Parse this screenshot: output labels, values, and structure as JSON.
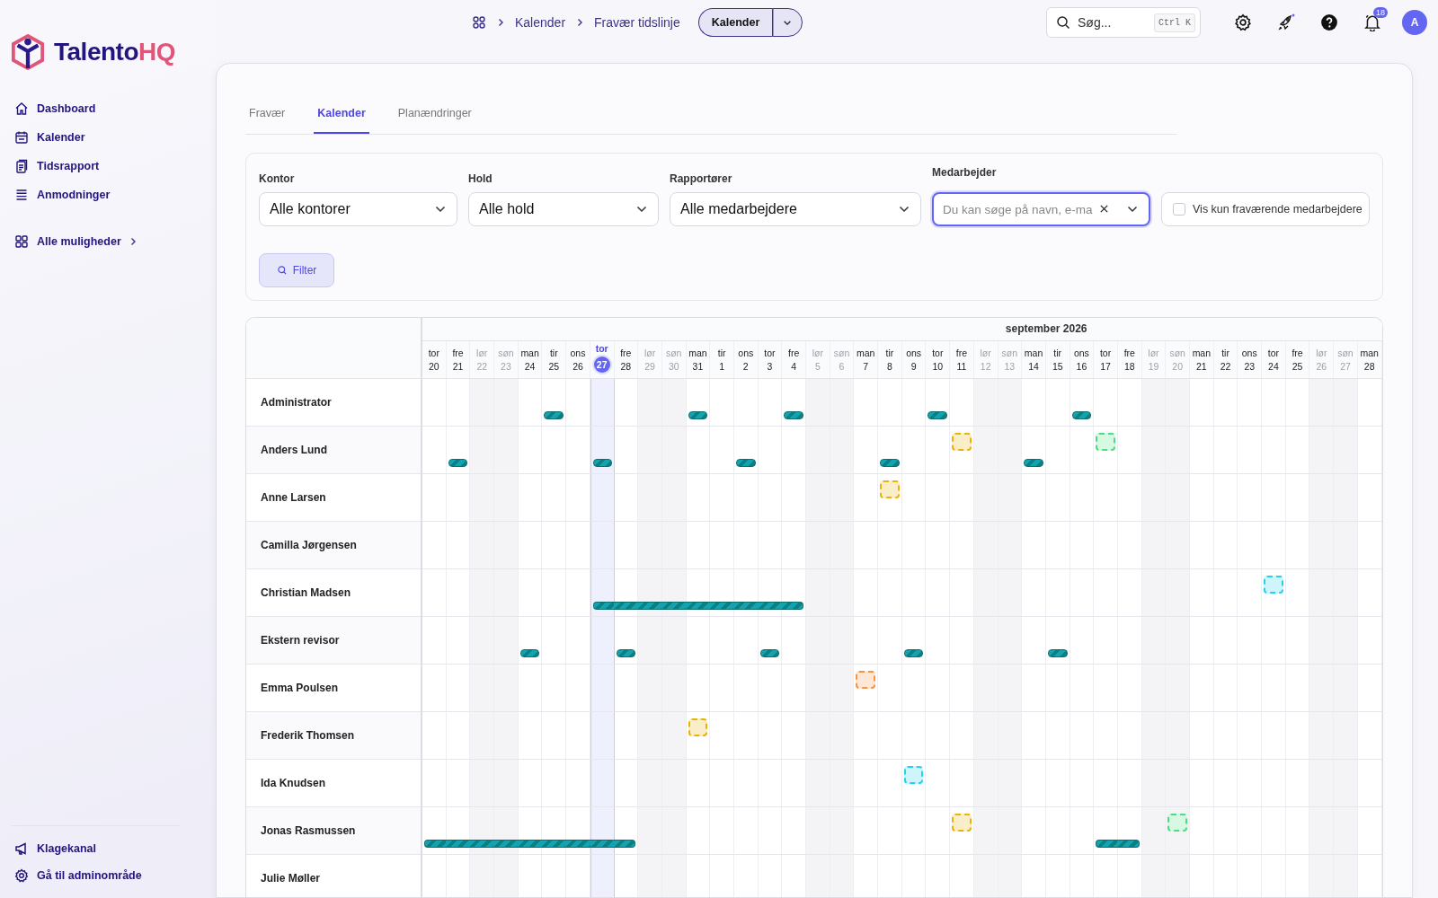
{
  "brand": {
    "name_part1": "Talento",
    "name_part2": "HQ"
  },
  "sidebar": {
    "items": [
      {
        "label": "Dashboard"
      },
      {
        "label": "Kalender"
      },
      {
        "label": "Tidsrapport"
      },
      {
        "label": "Anmodninger"
      }
    ],
    "more": {
      "label": "Alle muligheder"
    },
    "footer": [
      {
        "label": "Klagekanal"
      },
      {
        "label": "Gå til adminområde"
      }
    ]
  },
  "breadcrumbs": [
    "Kalender",
    "Fravær tidslinje"
  ],
  "view_switch": {
    "label": "Kalender"
  },
  "search": {
    "placeholder": "Søg...",
    "shortcut": "Ctrl K"
  },
  "notifications": {
    "count": "18"
  },
  "avatar": {
    "initial": "A"
  },
  "tabs": [
    {
      "label": "Fravær",
      "selected": false
    },
    {
      "label": "Kalender",
      "selected": true
    },
    {
      "label": "Planændringer",
      "selected": false
    }
  ],
  "filters": [
    {
      "label": "Kontor",
      "value": "Alle kontorer"
    },
    {
      "label": "Hold",
      "value": "Alle hold"
    },
    {
      "label": "Rapportører",
      "value": "Alle medarbejdere"
    }
  ],
  "employee_filter": {
    "label": "Medarbejder",
    "placeholder": "Du kan søge på navn, e-ma",
    "focused": true
  },
  "absent_only": {
    "label": "Vis kun fraværende medarbejdere",
    "checked": false
  },
  "filter_button": {
    "label": "Filter"
  },
  "calendar": {
    "month": "september 2026",
    "days": [
      {
        "weekday": "tor",
        "day": "20",
        "weekend": false,
        "today": false
      },
      {
        "weekday": "fre",
        "day": "21",
        "weekend": false,
        "today": false
      },
      {
        "weekday": "lør",
        "day": "22",
        "weekend": true,
        "today": false
      },
      {
        "weekday": "søn",
        "day": "23",
        "weekend": true,
        "today": false
      },
      {
        "weekday": "man",
        "day": "24",
        "weekend": false,
        "today": false
      },
      {
        "weekday": "tir",
        "day": "25",
        "weekend": false,
        "today": false
      },
      {
        "weekday": "ons",
        "day": "26",
        "weekend": false,
        "today": false
      },
      {
        "weekday": "tor",
        "day": "27",
        "weekend": false,
        "today": true
      },
      {
        "weekday": "fre",
        "day": "28",
        "weekend": false,
        "today": false
      },
      {
        "weekday": "lør",
        "day": "29",
        "weekend": true,
        "today": false
      },
      {
        "weekday": "søn",
        "day": "30",
        "weekend": true,
        "today": false
      },
      {
        "weekday": "man",
        "day": "31",
        "weekend": false,
        "today": false
      },
      {
        "weekday": "tir",
        "day": "1",
        "weekend": false,
        "today": false
      },
      {
        "weekday": "ons",
        "day": "2",
        "weekend": false,
        "today": false
      },
      {
        "weekday": "tor",
        "day": "3",
        "weekend": false,
        "today": false
      },
      {
        "weekday": "fre",
        "day": "4",
        "weekend": false,
        "today": false
      },
      {
        "weekday": "lør",
        "day": "5",
        "weekend": true,
        "today": false
      },
      {
        "weekday": "søn",
        "day": "6",
        "weekend": true,
        "today": false
      },
      {
        "weekday": "man",
        "day": "7",
        "weekend": false,
        "today": false
      },
      {
        "weekday": "tir",
        "day": "8",
        "weekend": false,
        "today": false
      },
      {
        "weekday": "ons",
        "day": "9",
        "weekend": false,
        "today": false
      },
      {
        "weekday": "tor",
        "day": "10",
        "weekend": false,
        "today": false
      },
      {
        "weekday": "fre",
        "day": "11",
        "weekend": false,
        "today": false
      },
      {
        "weekday": "lør",
        "day": "12",
        "weekend": true,
        "today": false
      },
      {
        "weekday": "søn",
        "day": "13",
        "weekend": true,
        "today": false
      },
      {
        "weekday": "man",
        "day": "14",
        "weekend": false,
        "today": false
      },
      {
        "weekday": "tir",
        "day": "15",
        "weekend": false,
        "today": false
      },
      {
        "weekday": "ons",
        "day": "16",
        "weekend": false,
        "today": false
      },
      {
        "weekday": "tor",
        "day": "17",
        "weekend": false,
        "today": false
      },
      {
        "weekday": "fre",
        "day": "18",
        "weekend": false,
        "today": false
      },
      {
        "weekday": "lør",
        "day": "19",
        "weekend": true,
        "today": false
      },
      {
        "weekday": "søn",
        "day": "20",
        "weekend": true,
        "today": false
      },
      {
        "weekday": "man",
        "day": "21",
        "weekend": false,
        "today": false
      },
      {
        "weekday": "tir",
        "day": "22",
        "weekend": false,
        "today": false
      },
      {
        "weekday": "ons",
        "day": "23",
        "weekend": false,
        "today": false
      },
      {
        "weekday": "tor",
        "day": "24",
        "weekend": false,
        "today": false
      },
      {
        "weekday": "fre",
        "day": "25",
        "weekend": false,
        "today": false
      },
      {
        "weekday": "lør",
        "day": "26",
        "weekend": true,
        "today": false
      },
      {
        "weekday": "søn",
        "day": "27",
        "weekend": true,
        "today": false
      },
      {
        "weekday": "man",
        "day": "28",
        "weekend": false,
        "today": false
      }
    ],
    "employees": [
      {
        "name": "Administrator",
        "cells": [
          {
            "absent": false
          },
          {
            "absent": false
          },
          {
            "absent": false
          },
          {
            "absent": false
          },
          {
            "absent": false
          },
          {
            "absent": true
          },
          {
            "absent": false
          },
          {
            "absent": false
          },
          {
            "absent": false
          },
          {
            "absent": false
          },
          {
            "absent": false
          },
          {
            "absent": true
          },
          {
            "absent": false
          },
          {
            "absent": false
          },
          {
            "absent": false
          },
          {
            "absent": true
          },
          {
            "absent": false
          },
          {
            "absent": false
          },
          {
            "absent": false
          },
          {
            "absent": false
          },
          {
            "absent": false
          },
          {
            "absent": true
          },
          {
            "absent": false
          },
          {
            "absent": false
          },
          {
            "absent": false
          },
          {
            "absent": false
          },
          {
            "absent": false
          },
          {
            "absent": true
          },
          {
            "absent": false
          },
          {
            "absent": false
          },
          {
            "absent": false
          },
          {
            "absent": false
          },
          {
            "absent": false
          },
          {
            "absent": false
          },
          {
            "absent": false
          },
          {
            "absent": false
          },
          {
            "absent": false
          },
          {
            "absent": false
          },
          {
            "absent": false
          },
          {
            "absent": false
          }
        ]
      },
      {
        "name": "Anders Lund",
        "cells": [
          {
            "absent": false
          },
          {
            "absent": true
          },
          {
            "absent": false
          },
          {
            "absent": false
          },
          {
            "absent": false
          },
          {
            "absent": false
          },
          {
            "absent": false
          },
          {
            "absent": true
          },
          {
            "absent": false
          },
          {
            "absent": false
          },
          {
            "absent": false
          },
          {
            "absent": false
          },
          {
            "absent": false
          },
          {
            "absent": true
          },
          {
            "absent": false
          },
          {
            "absent": false
          },
          {
            "absent": false
          },
          {
            "absent": false
          },
          {
            "absent": false
          },
          {
            "absent": true
          },
          {
            "absent": false
          },
          {
            "absent": false
          },
          {
            "absent": false,
            "color": "#eab308"
          },
          {
            "absent": false
          },
          {
            "absent": false
          },
          {
            "absent": true
          },
          {
            "absent": false
          },
          {
            "absent": false
          },
          {
            "absent": false,
            "color": "#4ade80"
          },
          {
            "absent": false
          },
          {
            "absent": false
          },
          {
            "absent": false
          },
          {
            "absent": false
          },
          {
            "absent": false
          },
          {
            "absent": false
          },
          {
            "absent": false
          },
          {
            "absent": false
          },
          {
            "absent": false
          },
          {
            "absent": false
          },
          {
            "absent": false
          }
        ]
      },
      {
        "name": "Anne Larsen",
        "cells": [
          {
            "absent": false
          },
          {
            "absent": false
          },
          {
            "absent": false
          },
          {
            "absent": false
          },
          {
            "absent": false
          },
          {
            "absent": false
          },
          {
            "absent": false
          },
          {
            "absent": false
          },
          {
            "absent": false
          },
          {
            "absent": false
          },
          {
            "absent": false
          },
          {
            "absent": false
          },
          {
            "absent": false
          },
          {
            "absent": false
          },
          {
            "absent": false
          },
          {
            "absent": false
          },
          {
            "absent": false
          },
          {
            "absent": false
          },
          {
            "absent": false
          },
          {
            "absent": false,
            "color": "#eab308"
          },
          {
            "absent": false
          },
          {
            "absent": false
          },
          {
            "absent": false
          },
          {
            "absent": false
          },
          {
            "absent": false
          },
          {
            "absent": false
          },
          {
            "absent": false
          },
          {
            "absent": false
          },
          {
            "absent": false
          },
          {
            "absent": false
          },
          {
            "absent": false
          },
          {
            "absent": false
          },
          {
            "absent": false
          },
          {
            "absent": false
          },
          {
            "absent": false
          },
          {
            "absent": false
          },
          {
            "absent": false
          },
          {
            "absent": false
          },
          {
            "absent": false
          },
          {
            "absent": false
          }
        ]
      },
      {
        "name": "Camilla Jørgensen",
        "cells": [
          {
            "absent": false
          },
          {
            "absent": false
          },
          {
            "absent": false
          },
          {
            "absent": false
          },
          {
            "absent": false
          },
          {
            "absent": false
          },
          {
            "absent": false
          },
          {
            "absent": false
          },
          {
            "absent": false
          },
          {
            "absent": false
          },
          {
            "absent": false
          },
          {
            "absent": false
          },
          {
            "absent": false
          },
          {
            "absent": false
          },
          {
            "absent": false
          },
          {
            "absent": false
          },
          {
            "absent": false
          },
          {
            "absent": false
          },
          {
            "absent": false
          },
          {
            "absent": false
          },
          {
            "absent": false
          },
          {
            "absent": false
          },
          {
            "absent": false
          },
          {
            "absent": false
          },
          {
            "absent": false
          },
          {
            "absent": false
          },
          {
            "absent": false
          },
          {
            "absent": false
          },
          {
            "absent": false
          },
          {
            "absent": false
          },
          {
            "absent": false
          },
          {
            "absent": false
          },
          {
            "absent": false
          },
          {
            "absent": false
          },
          {
            "absent": false
          },
          {
            "absent": false
          },
          {
            "absent": false
          },
          {
            "absent": false
          },
          {
            "absent": false
          },
          {
            "absent": false
          }
        ]
      },
      {
        "name": "Christian Madsen",
        "cells": [
          {
            "absent": false
          },
          {
            "absent": false
          },
          {
            "absent": false
          },
          {
            "absent": false
          },
          {
            "absent": false
          },
          {
            "absent": false
          },
          {
            "absent": false
          },
          {
            "absent": true
          },
          {
            "absent": true
          },
          {
            "absent": true
          },
          {
            "absent": true
          },
          {
            "absent": true
          },
          {
            "absent": true
          },
          {
            "absent": true
          },
          {
            "absent": true
          },
          {
            "absent": true
          },
          {
            "absent": false
          },
          {
            "absent": false
          },
          {
            "absent": false
          },
          {
            "absent": false
          },
          {
            "absent": false
          },
          {
            "absent": false
          },
          {
            "absent": false
          },
          {
            "absent": false
          },
          {
            "absent": false
          },
          {
            "absent": false
          },
          {
            "absent": false
          },
          {
            "absent": false
          },
          {
            "absent": false
          },
          {
            "absent": false
          },
          {
            "absent": false
          },
          {
            "absent": false
          },
          {
            "absent": false
          },
          {
            "absent": false
          },
          {
            "absent": false
          },
          {
            "absent": false,
            "color": "#22d3ee"
          },
          {
            "absent": false
          },
          {
            "absent": false
          },
          {
            "absent": false
          },
          {
            "absent": false
          }
        ]
      },
      {
        "name": "Ekstern revisor",
        "cells": [
          {
            "absent": false
          },
          {
            "absent": false
          },
          {
            "absent": false
          },
          {
            "absent": false
          },
          {
            "absent": true
          },
          {
            "absent": false
          },
          {
            "absent": false
          },
          {
            "absent": false
          },
          {
            "absent": true
          },
          {
            "absent": false
          },
          {
            "absent": false
          },
          {
            "absent": false
          },
          {
            "absent": false
          },
          {
            "absent": false
          },
          {
            "absent": true
          },
          {
            "absent": false
          },
          {
            "absent": false
          },
          {
            "absent": false
          },
          {
            "absent": false
          },
          {
            "absent": false
          },
          {
            "absent": true
          },
          {
            "absent": false
          },
          {
            "absent": false
          },
          {
            "absent": false
          },
          {
            "absent": false
          },
          {
            "absent": false
          },
          {
            "absent": true
          },
          {
            "absent": false
          },
          {
            "absent": false
          },
          {
            "absent": false
          },
          {
            "absent": false
          },
          {
            "absent": false
          },
          {
            "absent": false
          },
          {
            "absent": false
          },
          {
            "absent": false
          },
          {
            "absent": false
          },
          {
            "absent": false
          },
          {
            "absent": false
          },
          {
            "absent": false
          },
          {
            "absent": false
          }
        ]
      },
      {
        "name": "Emma Poulsen",
        "cells": [
          {
            "absent": false
          },
          {
            "absent": false
          },
          {
            "absent": false
          },
          {
            "absent": false
          },
          {
            "absent": false
          },
          {
            "absent": false
          },
          {
            "absent": false
          },
          {
            "absent": false
          },
          {
            "absent": false
          },
          {
            "absent": false
          },
          {
            "absent": false
          },
          {
            "absent": false
          },
          {
            "absent": false
          },
          {
            "absent": false
          },
          {
            "absent": false
          },
          {
            "absent": false
          },
          {
            "absent": false
          },
          {
            "absent": false
          },
          {
            "absent": false,
            "color": "#fb923c"
          },
          {
            "absent": false
          },
          {
            "absent": false
          },
          {
            "absent": false
          },
          {
            "absent": false
          },
          {
            "absent": false
          },
          {
            "absent": false
          },
          {
            "absent": false
          },
          {
            "absent": false
          },
          {
            "absent": false
          },
          {
            "absent": false
          },
          {
            "absent": false
          },
          {
            "absent": false
          },
          {
            "absent": false
          },
          {
            "absent": false
          },
          {
            "absent": false
          },
          {
            "absent": false
          },
          {
            "absent": false
          },
          {
            "absent": false
          },
          {
            "absent": false
          },
          {
            "absent": false
          },
          {
            "absent": false
          }
        ]
      },
      {
        "name": "Frederik Thomsen",
        "cells": [
          {
            "absent": false
          },
          {
            "absent": false
          },
          {
            "absent": false
          },
          {
            "absent": false
          },
          {
            "absent": false
          },
          {
            "absent": false
          },
          {
            "absent": false
          },
          {
            "absent": false
          },
          {
            "absent": false
          },
          {
            "absent": false
          },
          {
            "absent": false
          },
          {
            "absent": false,
            "color": "#eab308"
          },
          {
            "absent": false
          },
          {
            "absent": false
          },
          {
            "absent": false
          },
          {
            "absent": false
          },
          {
            "absent": false
          },
          {
            "absent": false
          },
          {
            "absent": false
          },
          {
            "absent": false
          },
          {
            "absent": false
          },
          {
            "absent": false
          },
          {
            "absent": false
          },
          {
            "absent": false
          },
          {
            "absent": false
          },
          {
            "absent": false
          },
          {
            "absent": false
          },
          {
            "absent": false
          },
          {
            "absent": false
          },
          {
            "absent": false
          },
          {
            "absent": false
          },
          {
            "absent": false
          },
          {
            "absent": false
          },
          {
            "absent": false
          },
          {
            "absent": false
          },
          {
            "absent": false
          },
          {
            "absent": false
          },
          {
            "absent": false
          },
          {
            "absent": false
          },
          {
            "absent": false
          }
        ]
      },
      {
        "name": "Ida Knudsen",
        "cells": [
          {
            "absent": false
          },
          {
            "absent": false
          },
          {
            "absent": false
          },
          {
            "absent": false
          },
          {
            "absent": false
          },
          {
            "absent": false
          },
          {
            "absent": false
          },
          {
            "absent": false
          },
          {
            "absent": false
          },
          {
            "absent": false
          },
          {
            "absent": false
          },
          {
            "absent": false
          },
          {
            "absent": false
          },
          {
            "absent": false
          },
          {
            "absent": false
          },
          {
            "absent": false
          },
          {
            "absent": false
          },
          {
            "absent": false
          },
          {
            "absent": false
          },
          {
            "absent": false
          },
          {
            "absent": false,
            "color": "#22d3ee"
          },
          {
            "absent": false
          },
          {
            "absent": false
          },
          {
            "absent": false
          },
          {
            "absent": false
          },
          {
            "absent": false
          },
          {
            "absent": false
          },
          {
            "absent": false
          },
          {
            "absent": false
          },
          {
            "absent": false
          },
          {
            "absent": false
          },
          {
            "absent": false
          },
          {
            "absent": false
          },
          {
            "absent": false
          },
          {
            "absent": false
          },
          {
            "absent": false
          },
          {
            "absent": false
          },
          {
            "absent": false
          },
          {
            "absent": false
          },
          {
            "absent": false
          }
        ]
      },
      {
        "name": "Jonas Rasmussen",
        "cells": [
          {
            "absent": true
          },
          {
            "absent": true
          },
          {
            "absent": true
          },
          {
            "absent": true
          },
          {
            "absent": true
          },
          {
            "absent": true
          },
          {
            "absent": true
          },
          {
            "absent": true
          },
          {
            "absent": true
          },
          {
            "absent": false
          },
          {
            "absent": false
          },
          {
            "absent": false
          },
          {
            "absent": false
          },
          {
            "absent": false
          },
          {
            "absent": false
          },
          {
            "absent": false
          },
          {
            "absent": false
          },
          {
            "absent": false
          },
          {
            "absent": false
          },
          {
            "absent": false
          },
          {
            "absent": false
          },
          {
            "absent": false
          },
          {
            "absent": false,
            "color": "#eab308"
          },
          {
            "absent": false
          },
          {
            "absent": false
          },
          {
            "absent": false
          },
          {
            "absent": false
          },
          {
            "absent": false
          },
          {
            "absent": true
          },
          {
            "absent": true
          },
          {
            "absent": false
          },
          {
            "absent": false,
            "color": "#4ade80"
          },
          {
            "absent": false
          },
          {
            "absent": false
          },
          {
            "absent": false
          },
          {
            "absent": false
          },
          {
            "absent": false
          },
          {
            "absent": false
          },
          {
            "absent": false
          },
          {
            "absent": false
          }
        ]
      },
      {
        "name": "Julie Møller",
        "cells": [
          {
            "absent": false
          },
          {
            "absent": false
          },
          {
            "absent": false
          },
          {
            "absent": false
          },
          {
            "absent": false
          },
          {
            "absent": false
          },
          {
            "absent": false
          },
          {
            "absent": false
          },
          {
            "absent": false
          },
          {
            "absent": false
          },
          {
            "absent": false
          },
          {
            "absent": false
          },
          {
            "absent": false
          },
          {
            "absent": false
          },
          {
            "absent": false
          },
          {
            "absent": false
          },
          {
            "absent": false
          },
          {
            "absent": false
          },
          {
            "absent": false
          },
          {
            "absent": false
          },
          {
            "absent": false
          },
          {
            "absent": false
          },
          {
            "absent": false
          },
          {
            "absent": false
          },
          {
            "absent": false
          },
          {
            "absent": false
          },
          {
            "absent": false
          },
          {
            "absent": false
          },
          {
            "absent": false
          },
          {
            "absent": false
          },
          {
            "absent": false
          },
          {
            "absent": false
          },
          {
            "absent": false
          },
          {
            "absent": false
          },
          {
            "absent": false
          },
          {
            "absent": false
          },
          {
            "absent": false
          },
          {
            "absent": false
          },
          {
            "absent": false
          },
          {
            "absent": false
          }
        ]
      }
    ]
  }
}
